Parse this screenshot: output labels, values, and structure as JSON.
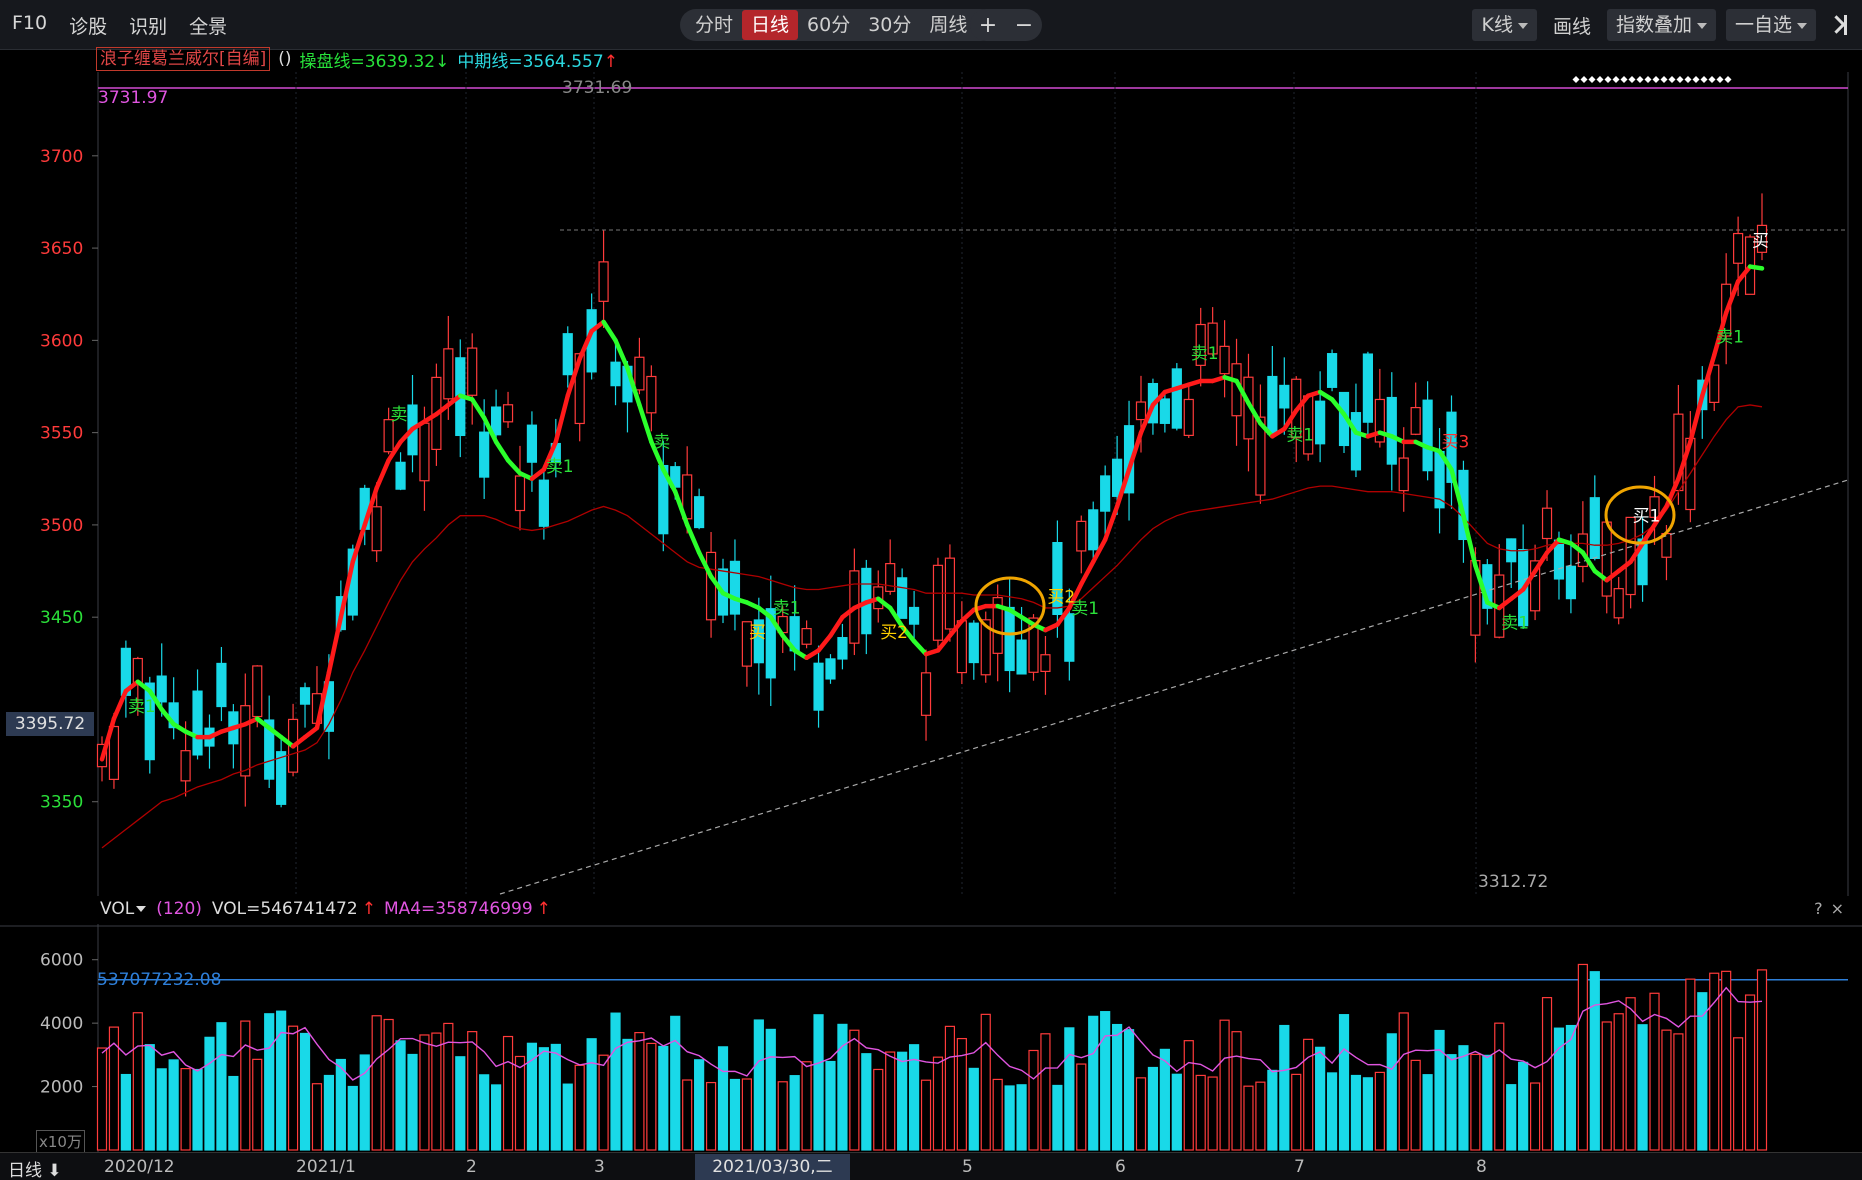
{
  "toolbar": {
    "left_items": [
      "F10",
      "诊股",
      "识别",
      "全景"
    ],
    "periods": [
      "分时",
      "日线",
      "60分",
      "30分",
      "周线"
    ],
    "active_period": "日线",
    "zoom_in": "+",
    "zoom_out": "−",
    "kline_label": "K线",
    "draw_label": "画线",
    "overlay_label": "指数叠加",
    "watchlist_label": "一自选"
  },
  "indicator": {
    "name": "浪子缠葛兰威尔[自编]",
    "params": "()",
    "op_line": "操盘线=3639.32↓",
    "mid_line": "中期线=3564.557",
    "mid_arrow": "↑"
  },
  "main_axis": {
    "ticks": [
      {
        "label": "3700",
        "value": 3700,
        "color": "#ff3b3b"
      },
      {
        "label": "3650",
        "value": 3650,
        "color": "#ff3b3b"
      },
      {
        "label": "3600",
        "value": 3600,
        "color": "#ff3b3b"
      },
      {
        "label": "3550",
        "value": 3550,
        "color": "#ff3b3b"
      },
      {
        "label": "3500",
        "value": 3500,
        "color": "#ff3b3b"
      },
      {
        "label": "3450",
        "value": 3450,
        "color": "#2be03a"
      },
      {
        "label": "3350",
        "value": 3350,
        "color": "#2be03a"
      }
    ],
    "current_price": "3395.72",
    "high_left": "3731.97",
    "high_mid": "3731.69",
    "low_label": "3312.72"
  },
  "signals": [
    {
      "text": "卖1",
      "color": "#2be03a"
    },
    {
      "text": "卖",
      "color": "#2be03a"
    },
    {
      "text": "卖1",
      "color": "#2be03a"
    },
    {
      "text": "卖",
      "color": "#2be03a"
    },
    {
      "text": "买",
      "color": "#ffd000"
    },
    {
      "text": "卖1",
      "color": "#2be03a"
    },
    {
      "text": "买2",
      "color": "#ffd000"
    },
    {
      "text": "买2",
      "color": "#ffd000"
    },
    {
      "text": "卖1",
      "color": "#2be03a"
    },
    {
      "text": "卖1",
      "color": "#2be03a"
    },
    {
      "text": "卖1",
      "color": "#2be03a"
    },
    {
      "text": "买3",
      "color": "#ff3030"
    },
    {
      "text": "卖1",
      "color": "#2be03a"
    },
    {
      "text": "买1",
      "color": "#ffffff"
    },
    {
      "text": "卖1",
      "color": "#2be03a"
    },
    {
      "text": "买",
      "color": "#ffffff"
    }
  ],
  "volume": {
    "name": "VOL",
    "period": "(120)",
    "vol_value": "VOL=546741472",
    "ma4_value": "MA4=358746999",
    "arrow": "↑",
    "reference": "537077232.08",
    "ticks": [
      "6000",
      "4000",
      "2000"
    ],
    "unit": "x10万",
    "help": "?",
    "close": "×"
  },
  "date_axis": {
    "period_button": "日线",
    "labels": [
      "2020/12",
      "2021/1",
      "2",
      "3",
      "5",
      "6",
      "7",
      "8"
    ],
    "cursor_date": "2021/03/30,二"
  },
  "colors": {
    "up": "#ff3b3b",
    "down": "#19d9e8",
    "op_line_up": "#ff1a1a",
    "op_line_down": "#2bff2b",
    "mid_line": "#b00000",
    "highlight_circle": "#f0a500"
  },
  "chart_data": {
    "type": "candlestick",
    "ylim": [
      3300,
      3740
    ],
    "volume_ylim": [
      0,
      7000
    ],
    "op_line": [
      3373,
      3395,
      3410,
      3415,
      3410,
      3400,
      3392,
      3388,
      3385,
      3385,
      3388,
      3390,
      3392,
      3395,
      3390,
      3385,
      3380,
      3385,
      3390,
      3420,
      3450,
      3480,
      3500,
      3520,
      3535,
      3545,
      3552,
      3556,
      3560,
      3565,
      3570,
      3568,
      3558,
      3545,
      3535,
      3528,
      3525,
      3530,
      3545,
      3570,
      3590,
      3605,
      3610,
      3600,
      3585,
      3565,
      3545,
      3530,
      3518,
      3500,
      3485,
      3472,
      3463,
      3460,
      3458,
      3455,
      3450,
      3440,
      3432,
      3428,
      3432,
      3440,
      3450,
      3455,
      3458,
      3460,
      3455,
      3445,
      3437,
      3430,
      3432,
      3440,
      3448,
      3454,
      3456,
      3456,
      3454,
      3450,
      3446,
      3443,
      3446,
      3455,
      3468,
      3480,
      3492,
      3510,
      3530,
      3550,
      3565,
      3572,
      3574,
      3576,
      3578,
      3578,
      3580,
      3578,
      3566,
      3555,
      3548,
      3552,
      3562,
      3570,
      3572,
      3568,
      3560,
      3550,
      3548,
      3550,
      3548,
      3545,
      3545,
      3542,
      3540,
      3530,
      3505,
      3478,
      3458,
      3455,
      3460,
      3465,
      3475,
      3485,
      3492,
      3490,
      3485,
      3475,
      3470,
      3475,
      3480,
      3490,
      3500,
      3510,
      3525,
      3545,
      3570,
      3592,
      3615,
      3632,
      3640,
      3639
    ],
    "mid_line": [
      3325,
      3330,
      3335,
      3340,
      3345,
      3350,
      3352,
      3355,
      3358,
      3360,
      3362,
      3365,
      3367,
      3370,
      3372,
      3374,
      3376,
      3378,
      3382,
      3392,
      3405,
      3420,
      3432,
      3445,
      3458,
      3470,
      3480,
      3487,
      3493,
      3500,
      3505,
      3505,
      3505,
      3503,
      3500,
      3498,
      3497,
      3498,
      3500,
      3502,
      3505,
      3508,
      3510,
      3508,
      3505,
      3500,
      3495,
      3490,
      3485,
      3480,
      3477,
      3476,
      3475,
      3474,
      3473,
      3472,
      3470,
      3468,
      3466,
      3465,
      3465,
      3466,
      3467,
      3468,
      3468,
      3468,
      3467,
      3466,
      3465,
      3463,
      3463,
      3463,
      3463,
      3462,
      3462,
      3462,
      3461,
      3460,
      3458,
      3455,
      3455,
      3456,
      3460,
      3466,
      3472,
      3478,
      3485,
      3492,
      3498,
      3502,
      3505,
      3507,
      3508,
      3509,
      3510,
      3511,
      3512,
      3513,
      3514,
      3516,
      3518,
      3520,
      3521,
      3521,
      3520,
      3519,
      3518,
      3518,
      3518,
      3517,
      3516,
      3515,
      3514,
      3510,
      3504,
      3497,
      3490,
      3487,
      3486,
      3486,
      3487,
      3489,
      3490,
      3490,
      3490,
      3489,
      3489,
      3490,
      3492,
      3495,
      3500,
      3508,
      3518,
      3528,
      3538,
      3548,
      3557,
      3564,
      3565,
      3564
    ]
  }
}
